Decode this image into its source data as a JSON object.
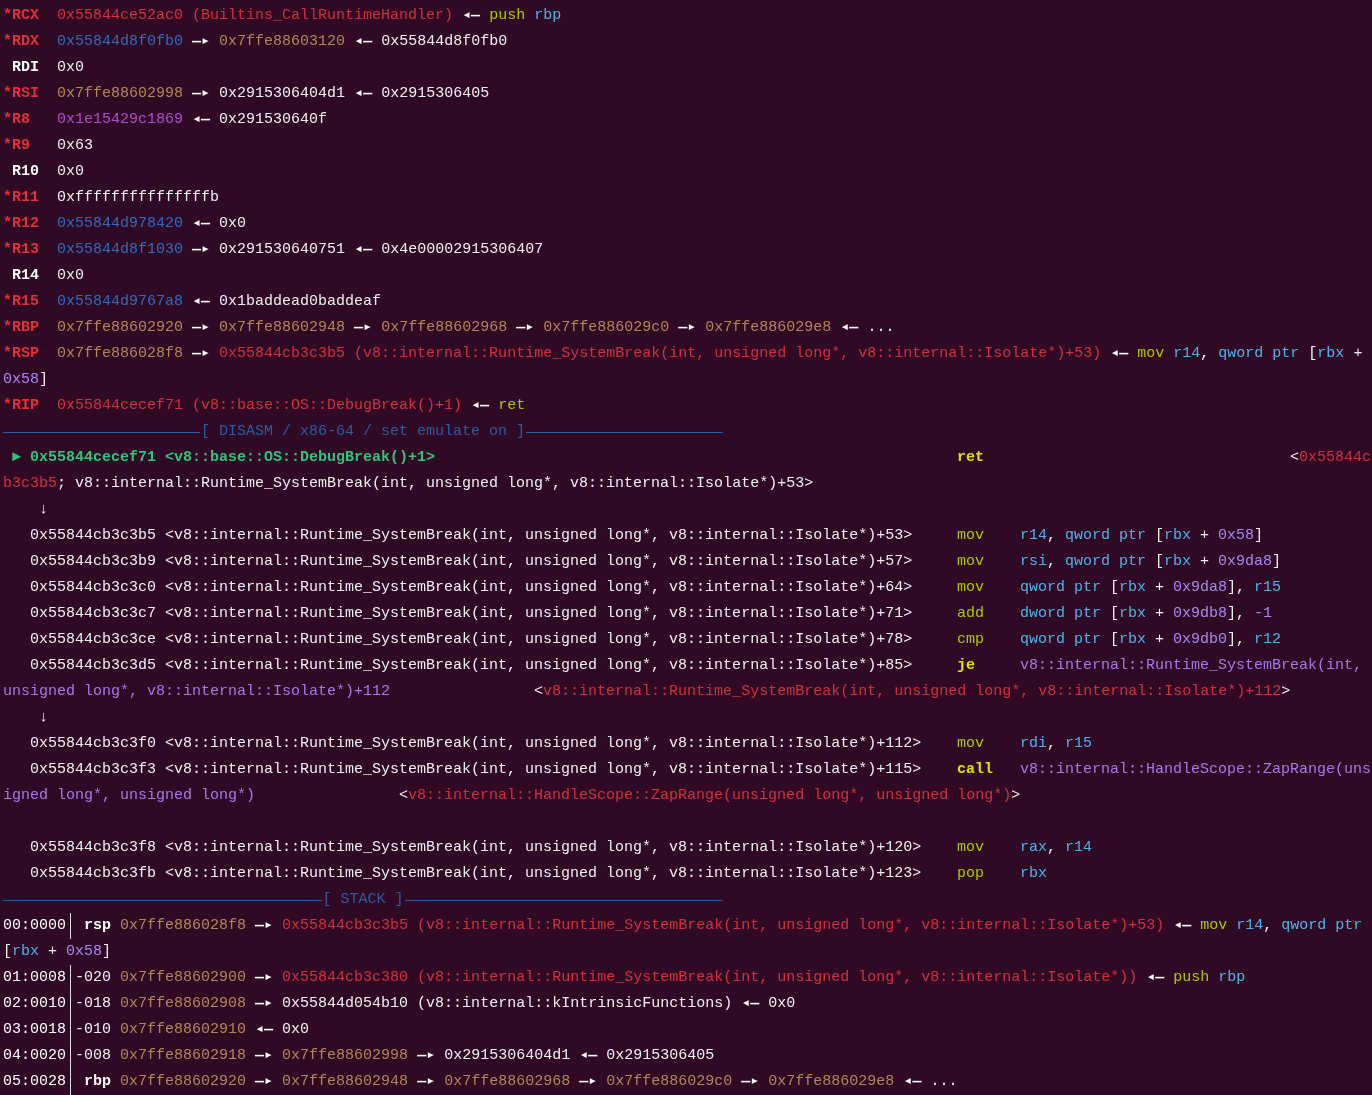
{
  "registers": [
    {
      "name": "*RCX",
      "changed": true,
      "segments": [
        {
          "kind": "code",
          "text": "0x55844ce52ac0 (Builtins_CallRuntimeHandler)"
        },
        {
          "kind": "arrow",
          "text": "◂—"
        },
        {
          "kind": "mnem",
          "text": "push"
        },
        {
          "kind": "oreg",
          "text": "rbp"
        }
      ]
    },
    {
      "name": "*RDX",
      "changed": true,
      "segments": [
        {
          "kind": "heap",
          "text": "0x55844d8f0fb0"
        },
        {
          "kind": "arrow",
          "text": "—▸"
        },
        {
          "kind": "stack",
          "text": "0x7ffe88603120"
        },
        {
          "kind": "arrow",
          "text": "◂—"
        },
        {
          "kind": "plain",
          "text": "0x55844d8f0fb0"
        }
      ]
    },
    {
      "name": "RDI",
      "changed": false,
      "segments": [
        {
          "kind": "plain",
          "text": "0x0"
        }
      ]
    },
    {
      "name": "*RSI",
      "changed": true,
      "segments": [
        {
          "kind": "stack",
          "text": "0x7ffe88602998"
        },
        {
          "kind": "arrow",
          "text": "—▸"
        },
        {
          "kind": "plain",
          "text": "0x2915306404d1"
        },
        {
          "kind": "arrow",
          "text": "◂—"
        },
        {
          "kind": "plain",
          "text": "0x2915306405"
        }
      ]
    },
    {
      "name": "*R8",
      "changed": true,
      "segments": [
        {
          "kind": "rwx",
          "text": "0x1e15429c1869"
        },
        {
          "kind": "arrow",
          "text": "◂—"
        },
        {
          "kind": "plain",
          "text": "0x291530640f"
        }
      ]
    },
    {
      "name": "*R9",
      "changed": true,
      "segments": [
        {
          "kind": "plain",
          "text": "0x63"
        }
      ]
    },
    {
      "name": "R10",
      "changed": false,
      "segments": [
        {
          "kind": "plain",
          "text": "0x0"
        }
      ]
    },
    {
      "name": "*R11",
      "changed": true,
      "segments": [
        {
          "kind": "plain",
          "text": "0xfffffffffffffffb"
        }
      ]
    },
    {
      "name": "*R12",
      "changed": true,
      "segments": [
        {
          "kind": "heap",
          "text": "0x55844d978420"
        },
        {
          "kind": "arrow",
          "text": "◂—"
        },
        {
          "kind": "plain",
          "text": "0x0"
        }
      ]
    },
    {
      "name": "*R13",
      "changed": true,
      "segments": [
        {
          "kind": "heap",
          "text": "0x55844d8f1030"
        },
        {
          "kind": "arrow",
          "text": "—▸"
        },
        {
          "kind": "plain",
          "text": "0x291530640751"
        },
        {
          "kind": "arrow",
          "text": "◂—"
        },
        {
          "kind": "plain",
          "text": "0x4e00002915306407"
        }
      ]
    },
    {
      "name": "R14",
      "changed": false,
      "segments": [
        {
          "kind": "plain",
          "text": "0x0"
        }
      ]
    },
    {
      "name": "*R15",
      "changed": true,
      "segments": [
        {
          "kind": "heap",
          "text": "0x55844d9767a8"
        },
        {
          "kind": "arrow",
          "text": "◂—"
        },
        {
          "kind": "plain",
          "text": "0x1baddead0baddeaf"
        }
      ]
    },
    {
      "name": "*RBP",
      "changed": true,
      "segments": [
        {
          "kind": "stack",
          "text": "0x7ffe88602920"
        },
        {
          "kind": "arrow",
          "text": "—▸"
        },
        {
          "kind": "stack",
          "text": "0x7ffe88602948"
        },
        {
          "kind": "arrow",
          "text": "—▸"
        },
        {
          "kind": "stack",
          "text": "0x7ffe88602968"
        },
        {
          "kind": "arrow",
          "text": "—▸"
        },
        {
          "kind": "stack",
          "text": "0x7ffe886029c0"
        },
        {
          "kind": "arrow",
          "text": "—▸"
        },
        {
          "kind": "stack",
          "text": "0x7ffe886029e8"
        },
        {
          "kind": "arrow",
          "text": "◂—"
        },
        {
          "kind": "plain",
          "text": "..."
        }
      ]
    },
    {
      "name": "*RSP",
      "changed": true,
      "segments": [
        {
          "kind": "stack",
          "text": "0x7ffe886028f8"
        },
        {
          "kind": "arrow",
          "text": "—▸"
        },
        {
          "kind": "code",
          "text": "0x55844cb3c3b5 (v8::internal::Runtime_SystemBreak(int, unsigned long*, v8::internal::Isolate*)+53)"
        },
        {
          "kind": "arrow",
          "text": "◂—"
        },
        {
          "kind": "mnem",
          "text": "mov"
        },
        {
          "kind": "oreg",
          "text": "r14"
        },
        {
          "kind": "plain",
          "text": ", "
        },
        {
          "kind": "oreg",
          "text": "qword ptr"
        },
        {
          "kind": "plain",
          "text": " ["
        },
        {
          "kind": "oreg",
          "text": "rbx"
        },
        {
          "kind": "plain",
          "text": " + "
        },
        {
          "kind": "num",
          "text": "0x58"
        },
        {
          "kind": "plain",
          "text": "]"
        }
      ]
    },
    {
      "name": "*RIP",
      "changed": true,
      "segments": [
        {
          "kind": "code",
          "text": "0x55844cecef71 (v8::base::OS::DebugBreak()+1)"
        },
        {
          "kind": "arrow",
          "text": "◂—"
        },
        {
          "kind": "mnem",
          "text": "ret"
        }
      ]
    }
  ],
  "disasm": {
    "header": "[ DISASM / x86-64 / set emulate on ]",
    "lines": [
      {
        "kind": "insn",
        "current": true,
        "marker": "►",
        "address": "0x55844cecef71",
        "symbol": "<v8::base::OS::DebugBreak()+1>",
        "mnemonic": "ret",
        "branch": true,
        "comment": [
          {
            "kind": "plain",
            "text": "<"
          },
          {
            "kind": "code",
            "text": "0x55844cb3c3b5"
          },
          {
            "kind": "plain",
            "text": "; v8::internal::Runtime_SystemBreak(int, unsigned long*, v8::internal::Isolate*)+53>"
          }
        ]
      },
      {
        "kind": "jump",
        "text": "↓"
      },
      {
        "kind": "insn",
        "current": false,
        "address": "0x55844cb3c3b5",
        "symbol": "<v8::internal::Runtime_SystemBreak(int, unsigned long*, v8::internal::Isolate*)+53>",
        "mnemonic": "mov",
        "branch": false,
        "operands": [
          {
            "kind": "oreg",
            "text": "r14"
          },
          {
            "kind": "plain",
            "text": ", "
          },
          {
            "kind": "oreg",
            "text": "qword ptr"
          },
          {
            "kind": "plain",
            "text": " ["
          },
          {
            "kind": "oreg",
            "text": "rbx"
          },
          {
            "kind": "plain",
            "text": " + "
          },
          {
            "kind": "num",
            "text": "0x58"
          },
          {
            "kind": "plain",
            "text": "]"
          }
        ]
      },
      {
        "kind": "insn",
        "current": false,
        "address": "0x55844cb3c3b9",
        "symbol": "<v8::internal::Runtime_SystemBreak(int, unsigned long*, v8::internal::Isolate*)+57>",
        "mnemonic": "mov",
        "branch": false,
        "operands": [
          {
            "kind": "oreg",
            "text": "rsi"
          },
          {
            "kind": "plain",
            "text": ", "
          },
          {
            "kind": "oreg",
            "text": "qword ptr"
          },
          {
            "kind": "plain",
            "text": " ["
          },
          {
            "kind": "oreg",
            "text": "rbx"
          },
          {
            "kind": "plain",
            "text": " + "
          },
          {
            "kind": "num",
            "text": "0x9da8"
          },
          {
            "kind": "plain",
            "text": "]"
          }
        ]
      },
      {
        "kind": "insn",
        "current": false,
        "address": "0x55844cb3c3c0",
        "symbol": "<v8::internal::Runtime_SystemBreak(int, unsigned long*, v8::internal::Isolate*)+64>",
        "mnemonic": "mov",
        "branch": false,
        "operands": [
          {
            "kind": "oreg",
            "text": "qword ptr"
          },
          {
            "kind": "plain",
            "text": " ["
          },
          {
            "kind": "oreg",
            "text": "rbx"
          },
          {
            "kind": "plain",
            "text": " + "
          },
          {
            "kind": "num",
            "text": "0x9da8"
          },
          {
            "kind": "plain",
            "text": "], "
          },
          {
            "kind": "oreg",
            "text": "r15"
          }
        ]
      },
      {
        "kind": "insn",
        "current": false,
        "address": "0x55844cb3c3c7",
        "symbol": "<v8::internal::Runtime_SystemBreak(int, unsigned long*, v8::internal::Isolate*)+71>",
        "mnemonic": "add",
        "branch": false,
        "operands": [
          {
            "kind": "oreg",
            "text": "dword ptr"
          },
          {
            "kind": "plain",
            "text": " ["
          },
          {
            "kind": "oreg",
            "text": "rbx"
          },
          {
            "kind": "plain",
            "text": " + "
          },
          {
            "kind": "num",
            "text": "0x9db8"
          },
          {
            "kind": "plain",
            "text": "], "
          },
          {
            "kind": "num",
            "text": "-1"
          }
        ]
      },
      {
        "kind": "insn",
        "current": false,
        "address": "0x55844cb3c3ce",
        "symbol": "<v8::internal::Runtime_SystemBreak(int, unsigned long*, v8::internal::Isolate*)+78>",
        "mnemonic": "cmp",
        "branch": false,
        "operands": [
          {
            "kind": "oreg",
            "text": "qword ptr"
          },
          {
            "kind": "plain",
            "text": " ["
          },
          {
            "kind": "oreg",
            "text": "rbx"
          },
          {
            "kind": "plain",
            "text": " + "
          },
          {
            "kind": "num",
            "text": "0x9db0"
          },
          {
            "kind": "plain",
            "text": "], "
          },
          {
            "kind": "oreg",
            "text": "r12"
          }
        ]
      },
      {
        "kind": "insn",
        "current": false,
        "address": "0x55844cb3c3d5",
        "symbol": "<v8::internal::Runtime_SystemBreak(int, unsigned long*, v8::internal::Isolate*)+85>",
        "mnemonic": "je",
        "branch": true,
        "operands": [
          {
            "kind": "target",
            "text": "v8::internal::Runtime_SystemBreak(int, unsigned long*, v8::internal::Isolate*)+112"
          }
        ],
        "comment": [
          {
            "kind": "plain",
            "text": "<"
          },
          {
            "kind": "code",
            "text": "v8::internal::Runtime_SystemBreak(int, unsigned long*, v8::internal::Isolate*)+112"
          },
          {
            "kind": "plain",
            "text": ">"
          }
        ]
      },
      {
        "kind": "jump",
        "text": "↓"
      },
      {
        "kind": "insn",
        "current": false,
        "address": "0x55844cb3c3f0",
        "symbol": "<v8::internal::Runtime_SystemBreak(int, unsigned long*, v8::internal::Isolate*)+112>",
        "mnemonic": "mov",
        "branch": false,
        "operands": [
          {
            "kind": "oreg",
            "text": "rdi"
          },
          {
            "kind": "plain",
            "text": ", "
          },
          {
            "kind": "oreg",
            "text": "r15"
          }
        ]
      },
      {
        "kind": "insn",
        "current": false,
        "address": "0x55844cb3c3f3",
        "symbol": "<v8::internal::Runtime_SystemBreak(int, unsigned long*, v8::internal::Isolate*)+115>",
        "mnemonic": "call",
        "branch": true,
        "operands": [
          {
            "kind": "target",
            "text": "v8::internal::HandleScope::ZapRange(unsigned long*, unsigned long*)"
          }
        ],
        "comment": [
          {
            "kind": "plain",
            "text": "<"
          },
          {
            "kind": "code",
            "text": "v8::internal::HandleScope::ZapRange(unsigned long*, unsigned long*)"
          },
          {
            "kind": "plain",
            "text": ">"
          }
        ]
      },
      {
        "kind": "blank"
      },
      {
        "kind": "insn",
        "current": false,
        "address": "0x55844cb3c3f8",
        "symbol": "<v8::internal::Runtime_SystemBreak(int, unsigned long*, v8::internal::Isolate*)+120>",
        "mnemonic": "mov",
        "branch": false,
        "operands": [
          {
            "kind": "oreg",
            "text": "rax"
          },
          {
            "kind": "plain",
            "text": ", "
          },
          {
            "kind": "oreg",
            "text": "r14"
          }
        ]
      },
      {
        "kind": "insn",
        "current": false,
        "address": "0x55844cb3c3fb",
        "symbol": "<v8::internal::Runtime_SystemBreak(int, unsigned long*, v8::internal::Isolate*)+123>",
        "mnemonic": "pop",
        "branch": false,
        "operands": [
          {
            "kind": "oreg",
            "text": "rbx"
          }
        ]
      }
    ]
  },
  "stack": {
    "header": "[ STACK ]",
    "rows": [
      {
        "offset": "00:0000",
        "frame": {
          "kind": "reg",
          "text": "rsp"
        },
        "segments": [
          {
            "kind": "stack",
            "text": "0x7ffe886028f8"
          },
          {
            "kind": "arrow",
            "text": "—▸"
          },
          {
            "kind": "code",
            "text": "0x55844cb3c3b5 (v8::internal::Runtime_SystemBreak(int, unsigned long*, v8::internal::Isolate*)+53)"
          },
          {
            "kind": "arrow",
            "text": "◂—"
          },
          {
            "kind": "mnem",
            "text": "mov"
          },
          {
            "kind": "oreg",
            "text": "r14"
          },
          {
            "kind": "plain",
            "text": ", "
          },
          {
            "kind": "oreg",
            "text": "qword ptr"
          },
          {
            "kind": "plain",
            "text": " ["
          },
          {
            "kind": "oreg",
            "text": "rbx"
          },
          {
            "kind": "plain",
            "text": " + "
          },
          {
            "kind": "num",
            "text": "0x58"
          },
          {
            "kind": "plain",
            "text": "]"
          }
        ]
      },
      {
        "offset": "01:0008",
        "frame": {
          "kind": "plain",
          "text": "-020"
        },
        "segments": [
          {
            "kind": "stack",
            "text": "0x7ffe88602900"
          },
          {
            "kind": "arrow",
            "text": "—▸"
          },
          {
            "kind": "code",
            "text": "0x55844cb3c380 (v8::internal::Runtime_SystemBreak(int, unsigned long*, v8::internal::Isolate*))"
          },
          {
            "kind": "arrow",
            "text": "◂—"
          },
          {
            "kind": "mnem",
            "text": "push"
          },
          {
            "kind": "oreg",
            "text": "rbp"
          }
        ]
      },
      {
        "offset": "02:0010",
        "frame": {
          "kind": "plain",
          "text": "-018"
        },
        "segments": [
          {
            "kind": "stack",
            "text": "0x7ffe88602908"
          },
          {
            "kind": "arrow",
            "text": "—▸"
          },
          {
            "kind": "plain",
            "text": "0x55844d054b10 (v8::internal::kIntrinsicFunctions)"
          },
          {
            "kind": "arrow",
            "text": "◂—"
          },
          {
            "kind": "plain",
            "text": "0x0"
          }
        ]
      },
      {
        "offset": "03:0018",
        "frame": {
          "kind": "plain",
          "text": "-010"
        },
        "segments": [
          {
            "kind": "stack",
            "text": "0x7ffe88602910"
          },
          {
            "kind": "arrow",
            "text": "◂—"
          },
          {
            "kind": "plain",
            "text": "0x0"
          }
        ]
      },
      {
        "offset": "04:0020",
        "frame": {
          "kind": "plain",
          "text": "-008"
        },
        "segments": [
          {
            "kind": "stack",
            "text": "0x7ffe88602918"
          },
          {
            "kind": "arrow",
            "text": "—▸"
          },
          {
            "kind": "stack",
            "text": "0x7ffe88602998"
          },
          {
            "kind": "arrow",
            "text": "—▸"
          },
          {
            "kind": "plain",
            "text": "0x2915306404d1"
          },
          {
            "kind": "arrow",
            "text": "◂—"
          },
          {
            "kind": "plain",
            "text": "0x2915306405"
          }
        ]
      },
      {
        "offset": "05:0028",
        "frame": {
          "kind": "reg",
          "text": "rbp"
        },
        "segments": [
          {
            "kind": "stack",
            "text": "0x7ffe88602920"
          },
          {
            "kind": "arrow",
            "text": "—▸"
          },
          {
            "kind": "stack",
            "text": "0x7ffe88602948"
          },
          {
            "kind": "arrow",
            "text": "—▸"
          },
          {
            "kind": "stack",
            "text": "0x7ffe88602968"
          },
          {
            "kind": "arrow",
            "text": "—▸"
          },
          {
            "kind": "stack",
            "text": "0x7ffe886029c0"
          },
          {
            "kind": "arrow",
            "text": "—▸"
          },
          {
            "kind": "stack",
            "text": "0x7ffe886029e8"
          },
          {
            "kind": "arrow",
            "text": "◂—"
          },
          {
            "kind": "plain",
            "text": "..."
          }
        ]
      }
    ]
  }
}
